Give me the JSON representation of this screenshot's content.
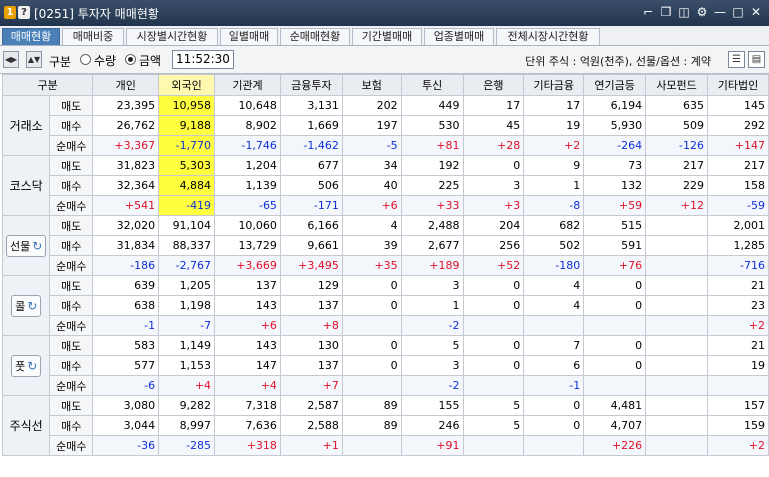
{
  "window": {
    "title": "[0251] 투자자 매매현황",
    "badge1": "1",
    "badge2": "?"
  },
  "tabs": [
    "매매현황",
    "매매비중",
    "시장별시간현황",
    "일별매매",
    "순매매현황",
    "기간별매매",
    "업종별매매",
    "전체시장시간현황"
  ],
  "toolbar": {
    "gubun_label": "구분",
    "opt_qty": "수량",
    "opt_amount": "금액",
    "time": "11:52:30",
    "unit_text": "단위 주식 : 억원(천주), 선물/옵션 : 계약"
  },
  "headers": [
    "구분",
    "개인",
    "외국인",
    "기관계",
    "금융투자",
    "보험",
    "투신",
    "은행",
    "기타금융",
    "연기금등",
    "사모펀드",
    "기타법인"
  ],
  "rowlabels": [
    "매도",
    "매수",
    "순매수"
  ],
  "sections": [
    {
      "label": "거래소",
      "rows": [
        [
          "23,395",
          "10,958",
          "10,648",
          "3,131",
          "202",
          "449",
          "17",
          "17",
          "6,194",
          "635",
          "145"
        ],
        [
          "26,762",
          "9,188",
          "8,902",
          "1,669",
          "197",
          "530",
          "45",
          "19",
          "5,930",
          "509",
          "292"
        ],
        [
          "+3,367",
          "-1,770",
          "-1,746",
          "-1,462",
          "-5",
          "+81",
          "+28",
          "+2",
          "-264",
          "-126",
          "+147"
        ]
      ]
    },
    {
      "label": "코스닥",
      "rows": [
        [
          "31,823",
          "5,303",
          "1,204",
          "677",
          "34",
          "192",
          "0",
          "9",
          "73",
          "217",
          "217"
        ],
        [
          "32,364",
          "4,884",
          "1,139",
          "506",
          "40",
          "225",
          "3",
          "1",
          "132",
          "229",
          "158"
        ],
        [
          "+541",
          "-419",
          "-65",
          "-171",
          "+6",
          "+33",
          "+3",
          "-8",
          "+59",
          "+12",
          "-59"
        ]
      ]
    },
    {
      "label": "선물",
      "rows": [
        [
          "32,020",
          "91,104",
          "10,060",
          "6,166",
          "4",
          "2,488",
          "204",
          "682",
          "515",
          "",
          "2,001"
        ],
        [
          "31,834",
          "88,337",
          "13,729",
          "9,661",
          "39",
          "2,677",
          "256",
          "502",
          "591",
          "",
          "1,285"
        ],
        [
          "-186",
          "-2,767",
          "+3,669",
          "+3,495",
          "+35",
          "+189",
          "+52",
          "-180",
          "+76",
          "",
          "-716"
        ]
      ]
    },
    {
      "label": "콜",
      "rows": [
        [
          "639",
          "1,205",
          "137",
          "129",
          "0",
          "3",
          "0",
          "4",
          "0",
          "",
          "21"
        ],
        [
          "638",
          "1,198",
          "143",
          "137",
          "0",
          "1",
          "0",
          "4",
          "0",
          "",
          "23"
        ],
        [
          "-1",
          "-7",
          "+6",
          "+8",
          "",
          "-2",
          "",
          "",
          "",
          "",
          "+2"
        ]
      ]
    },
    {
      "label": "풋",
      "rows": [
        [
          "583",
          "1,149",
          "143",
          "130",
          "0",
          "5",
          "0",
          "7",
          "0",
          "",
          "21"
        ],
        [
          "577",
          "1,153",
          "147",
          "137",
          "0",
          "3",
          "0",
          "6",
          "0",
          "",
          "19"
        ],
        [
          "-6",
          "+4",
          "+4",
          "+7",
          "",
          "-2",
          "",
          "-1",
          "",
          "",
          ""
        ]
      ]
    },
    {
      "label": "주식선",
      "rows": [
        [
          "3,080",
          "9,282",
          "7,318",
          "2,587",
          "89",
          "155",
          "5",
          "0",
          "4,481",
          "",
          "157"
        ],
        [
          "3,044",
          "8,997",
          "7,636",
          "2,588",
          "89",
          "246",
          "5",
          "0",
          "4,707",
          "",
          "159"
        ],
        [
          "-36",
          "-285",
          "+318",
          "+1",
          "",
          "+91",
          "",
          "",
          "+226",
          "",
          "+2"
        ]
      ]
    }
  ],
  "colors": {
    "up": "#e0102a",
    "down": "#1030d8",
    "highlight": "#ffff40"
  },
  "icons": [
    "window-pin-icon",
    "copy-icon",
    "camera-icon",
    "gear-icon",
    "minimize-icon",
    "maximize-icon",
    "close-icon"
  ]
}
